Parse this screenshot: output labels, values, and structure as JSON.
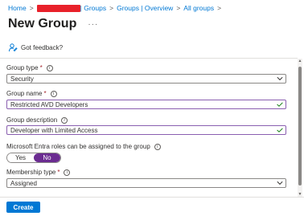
{
  "breadcrumb": {
    "home": "Home",
    "sep1": ">",
    "redacted_suffix": "| Groups",
    "sep2": ">",
    "overview": "Groups | Overview",
    "sep3": ">",
    "all_groups": "All groups",
    "sep4": ">"
  },
  "page": {
    "title": "New Group",
    "more": "···"
  },
  "feedback": {
    "label": "Got feedback?"
  },
  "form": {
    "group_type": {
      "label": "Group type",
      "required": "*",
      "value": "Security"
    },
    "group_name": {
      "label": "Group name",
      "required": "*",
      "value": "Restricted AVD Developers"
    },
    "group_description": {
      "label": "Group description",
      "value": "Developer with Limited Access"
    },
    "entra_roles": {
      "label": "Microsoft Entra roles can be assigned to the group",
      "yes": "Yes",
      "no": "No",
      "selected": "No"
    },
    "membership_type": {
      "label": "Membership type",
      "required": "*",
      "value": "Assigned"
    }
  },
  "footer": {
    "create_label": "Create"
  },
  "colors": {
    "accent": "#0078d4",
    "toggle_on": "#6b2c91",
    "required": "#a4262c",
    "valid_check": "#107c10"
  }
}
